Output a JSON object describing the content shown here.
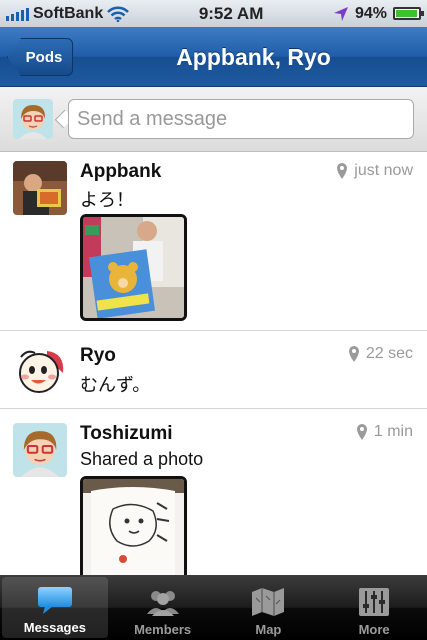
{
  "status_bar": {
    "carrier": "SoftBank",
    "time": "9:52 AM",
    "battery": "94%",
    "battery_level": 0.94,
    "icons": [
      "signal-icon",
      "wifi-icon",
      "location-arrow-icon",
      "battery-icon"
    ]
  },
  "nav": {
    "back_label": "Pods",
    "title": "Appbank, Ryo"
  },
  "compose": {
    "placeholder": "Send a message"
  },
  "posts": [
    {
      "name": "Appbank",
      "text": "よろ！",
      "time": "just now",
      "has_photo": true
    },
    {
      "name": "Ryo",
      "text": "むんず。",
      "time": "22 sec",
      "has_photo": false
    },
    {
      "name": "Toshizumi",
      "text": "Shared a photo",
      "time": "1 min",
      "has_photo": true
    }
  ],
  "tabs": [
    {
      "label": "Messages",
      "icon": "speech-bubble-icon",
      "active": true
    },
    {
      "label": "Members",
      "icon": "people-icon",
      "active": false
    },
    {
      "label": "Map",
      "icon": "map-icon",
      "active": false
    },
    {
      "label": "More",
      "icon": "sliders-icon",
      "active": false
    }
  ],
  "colors": {
    "nav_blue": "#1f5da8",
    "battery_green": "#3ec12f",
    "tab_bar": "#111111"
  }
}
